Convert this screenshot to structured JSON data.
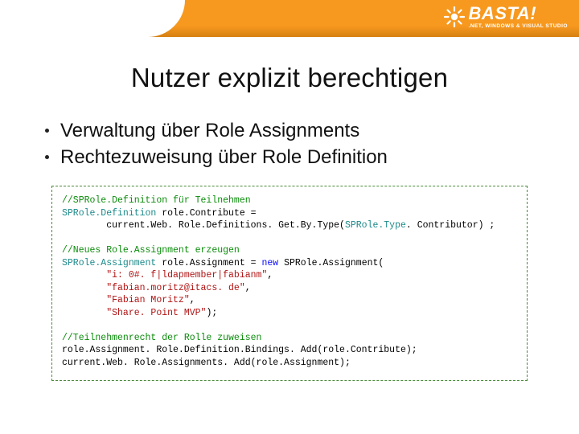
{
  "header": {
    "brand": "BASTA!",
    "tagline": ".NET, WINDOWS & VISUAL STUDIO"
  },
  "title": "Nutzer explizit berechtigen",
  "bullets": [
    "Verwaltung über Role Assignments",
    "Rechtezuweisung über Role Definition"
  ],
  "code": {
    "c1": "//SPRole.Definition für Teilnehmen",
    "l2a": "SPRole.Definition ",
    "l2b": "role.Contribute = ",
    "l3a": "        current.Web. Role.Definitions. Get.By.Type(",
    "l3b": "SPRole.Type",
    "l3c": ". Contributor) ;",
    "c2": "//Neues Role.Assignment erzeugen",
    "l5a": "SPRole.Assignment ",
    "l5b": "role.Assignment = ",
    "l5kw": "new",
    "l5c": " SPRole.Assignment(",
    "s1": "        \"i: 0#. f|ldapmember|fabianm\"",
    "s2": "        \"fabian.moritz@itacs. de\"",
    "s3": "        \"Fabian Moritz\"",
    "s4": "        \"Share. Point MVP\"",
    "comma": ",",
    "paren": ");",
    "c3": "//Teilnehmenrecht der Rolle zuweisen",
    "l10": "role.Assignment. Role.Definition.Bindings. Add(role.Contribute);",
    "l11": "current.Web. Role.Assignments. Add(role.Assignment);"
  }
}
